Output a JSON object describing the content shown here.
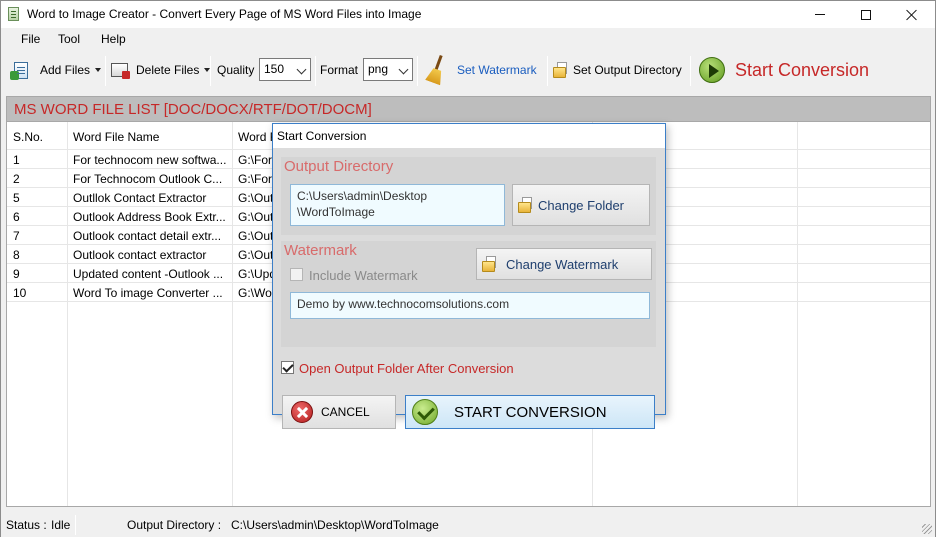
{
  "window": {
    "title": "Word to Image Creator - Convert Every Page of MS Word Files into Image",
    "controls": {
      "minimize_icon": "minimize-icon",
      "maximize_icon": "maximize-icon",
      "close_icon": "close-icon"
    }
  },
  "menu": {
    "items": [
      "File",
      "Tool",
      "Help"
    ]
  },
  "toolbar": {
    "add_files_label": "Add Files",
    "delete_files_label": "Delete Files",
    "quality_label": "Quality",
    "quality_value": "150",
    "format_label": "Format",
    "format_value": "png",
    "set_watermark_label": "Set Watermark",
    "set_output_dir_label": "Set Output Directory",
    "start_conversion_label": "Start Conversion",
    "accent_color": "#c62828",
    "link_color": "#1a5dbf"
  },
  "file_list": {
    "header": "MS WORD FILE LIST [DOC/DOCX/RTF/DOT/DOCM]",
    "columns": [
      "S.No.",
      "Word File Name",
      "Word F"
    ],
    "rows": [
      {
        "sno": "1",
        "name": "For technocom new softwa...",
        "path": "G:\\For"
      },
      {
        "sno": "2",
        "name": "For Technocom Outlook C...",
        "path": "G:\\For"
      },
      {
        "sno": "5",
        "name": "Outllok Contact Extractor",
        "path": "G:\\Out"
      },
      {
        "sno": "6",
        "name": "Outlook Address Book Extr...",
        "path": "G:\\Out"
      },
      {
        "sno": "7",
        "name": "Outlook contact detail extr...",
        "path": "G:\\Out"
      },
      {
        "sno": "8",
        "name": "Outlook contact extractor",
        "path": "G:\\Out"
      },
      {
        "sno": "9",
        "name": "Updated content -Outlook ...",
        "path": "G:\\Upd"
      },
      {
        "sno": "10",
        "name": "Word To image Converter ...",
        "path": "G:\\Wo"
      }
    ]
  },
  "status": {
    "status_label": "Status :",
    "status_value": "Idle",
    "output_label": "Output Directory :",
    "output_value": "C:\\Users\\admin\\Desktop\\WordToImage"
  },
  "dialog": {
    "title": "Start Conversion",
    "output_group_title": "Output Directory",
    "output_path_line1": "C:\\Users\\admin\\Desktop",
    "output_path_line2": "\\WordToImage",
    "change_folder_label": "Change Folder",
    "watermark_group_title": "Watermark",
    "include_watermark_label": "Include Watermark",
    "include_watermark_checked": false,
    "change_watermark_label": "Change Watermark",
    "watermark_text": "Demo by www.technocomsolutions.com",
    "open_folder_label": "Open Output Folder After Conversion",
    "open_folder_checked": true,
    "cancel_label": "CANCEL",
    "start_label": "START CONVERSION",
    "title_color": "#d86b6b"
  }
}
